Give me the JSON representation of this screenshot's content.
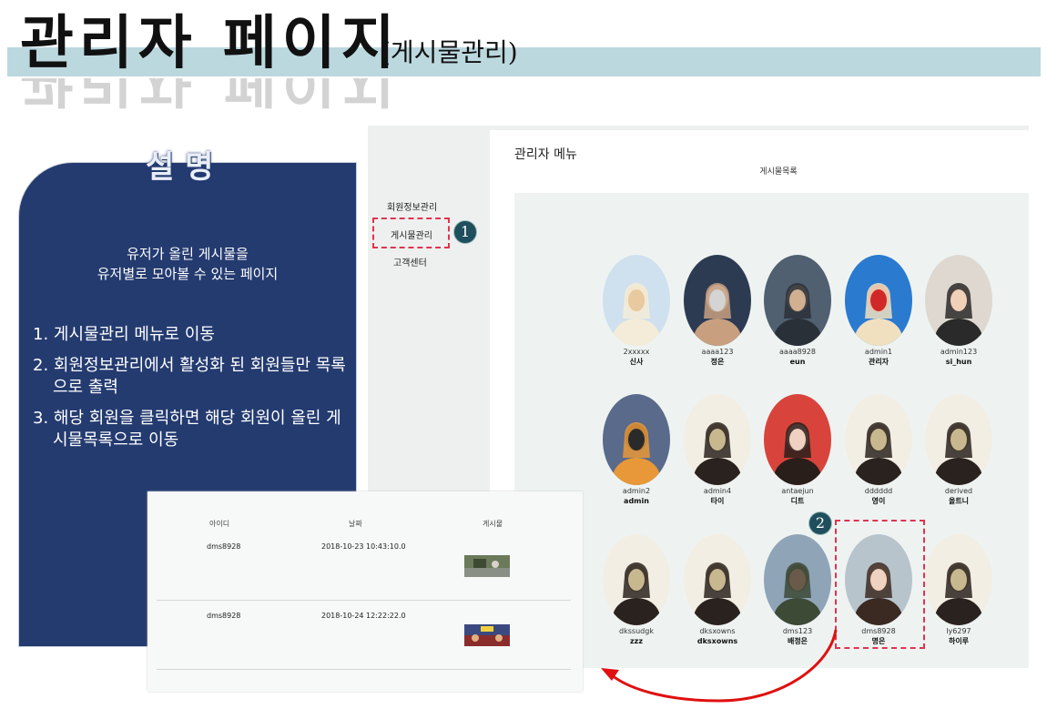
{
  "page_title": "관리자 페이지",
  "page_title_sub": "(게시물관리)",
  "description": {
    "heading": "설 명",
    "summary_line1": "유저가 올린 게시물을",
    "summary_line2": "유저별로 모아볼 수 있는 페이지",
    "steps": [
      "1. 게시물관리 메뉴로 이동",
      "2. 회원정보관리에서 활성화 된 회원들만 목록으로 출력",
      "3. 해당 회원을 클릭하면 해당 회원이 올린 게시물목록으로 이동"
    ]
  },
  "admin": {
    "menu_title": "관리자 메뉴",
    "subtitle": "게시물목록",
    "sidebar": [
      "회원정보관리",
      "게시물관리",
      "고객센터"
    ],
    "badges": [
      "1",
      "2"
    ],
    "members": [
      {
        "id": "2xxxxx",
        "name": "신사",
        "photo": "ice-cream"
      },
      {
        "id": "aaaa123",
        "name": "정은",
        "photo": "city-street"
      },
      {
        "id": "aaaa8928",
        "name": "eun",
        "photo": "cafe"
      },
      {
        "id": "admin1",
        "name": "관리자",
        "photo": "cartoon"
      },
      {
        "id": "admin123",
        "name": "si_hun",
        "photo": "friends"
      },
      {
        "id": "admin2",
        "name": "admin",
        "photo": "bear-character"
      },
      {
        "id": "admin4",
        "name": "타이",
        "photo": "portrait-flowers"
      },
      {
        "id": "antaejun",
        "name": "디트",
        "photo": "portrait-red"
      },
      {
        "id": "dddddd",
        "name": "영이",
        "photo": "portrait-flowers"
      },
      {
        "id": "derived",
        "name": "올트니",
        "photo": "portrait-flowers"
      },
      {
        "id": "dkssudgk",
        "name": "zzz",
        "photo": "portrait-flowers"
      },
      {
        "id": "dksxowns",
        "name": "dksxowns",
        "photo": "portrait-flowers"
      },
      {
        "id": "dms123",
        "name": "배정은",
        "photo": "park"
      },
      {
        "id": "dms8928",
        "name": "명은",
        "photo": "selfie"
      },
      {
        "id": "ly6297",
        "name": "하이루",
        "photo": "portrait-flowers"
      }
    ]
  },
  "posts": {
    "headers": [
      "아이디",
      "날짜",
      "게시물"
    ],
    "rows": [
      {
        "id": "dms8928",
        "date": "2018-10-23 10:43:10.0",
        "thumb": "street-thumb"
      },
      {
        "id": "dms8928",
        "date": "2018-10-24 12:22:22.0",
        "thumb": "city-thumb"
      }
    ]
  },
  "colors": {
    "description_bg": "#243b70",
    "title_band": "#bcd8df",
    "dashed_highlight": "#e0344e",
    "badge_bg": "#1f4e5c",
    "arrow": "#e01010"
  }
}
